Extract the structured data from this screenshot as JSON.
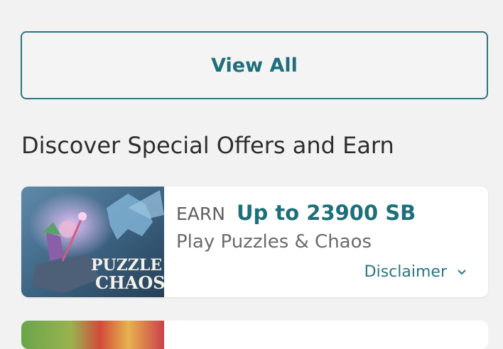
{
  "view_all": {
    "label": "View All"
  },
  "section": {
    "title": "Discover Special Offers and Earn"
  },
  "offers": [
    {
      "earn_label": "EARN",
      "amount": "Up to 23900 SB",
      "description": "Play Puzzles & Chaos",
      "disclaimer": "Disclaimer",
      "thumb_text_line1": "PUZZLE",
      "thumb_text_line2": "CHAOS"
    }
  ],
  "colors": {
    "accent": "#1e6f7b",
    "background": "#f2f2f2",
    "card": "#ffffff"
  }
}
